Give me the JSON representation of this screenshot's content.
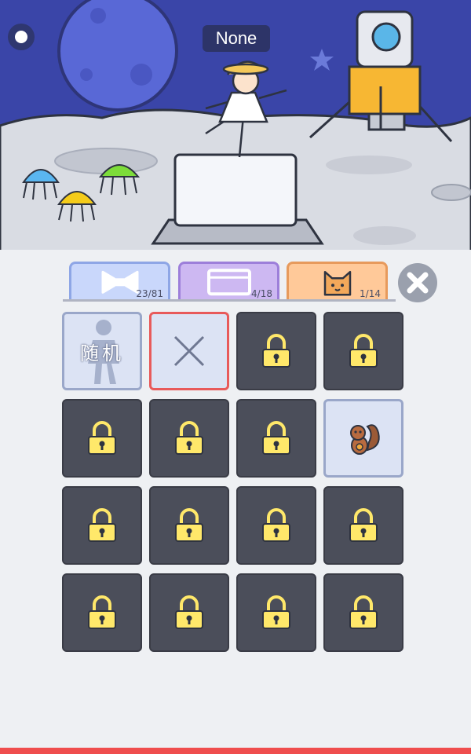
{
  "header": {
    "name_label": "None"
  },
  "tabs": [
    {
      "id": "accessories",
      "icon": "bow-icon",
      "count": "23/81"
    },
    {
      "id": "backgrounds",
      "icon": "frame-icon",
      "count": "4/18"
    },
    {
      "id": "pets",
      "icon": "cat-icon",
      "count": "1/14"
    }
  ],
  "grid": {
    "random_label": "随机",
    "cells": [
      {
        "state": "random"
      },
      {
        "state": "none-selected"
      },
      {
        "state": "locked"
      },
      {
        "state": "locked"
      },
      {
        "state": "locked"
      },
      {
        "state": "locked"
      },
      {
        "state": "locked"
      },
      {
        "state": "unlocked",
        "icon": "squirrel-icon"
      },
      {
        "state": "locked"
      },
      {
        "state": "locked"
      },
      {
        "state": "locked"
      },
      {
        "state": "locked"
      },
      {
        "state": "locked"
      },
      {
        "state": "locked"
      },
      {
        "state": "locked"
      },
      {
        "state": "locked"
      }
    ]
  },
  "colors": {
    "sky": "#3a45a8",
    "moon_ground": "#d8dbe2",
    "panel": "#eef0f3",
    "lock": "#ffe86a",
    "bottom_bar": "#ef4d4d"
  }
}
